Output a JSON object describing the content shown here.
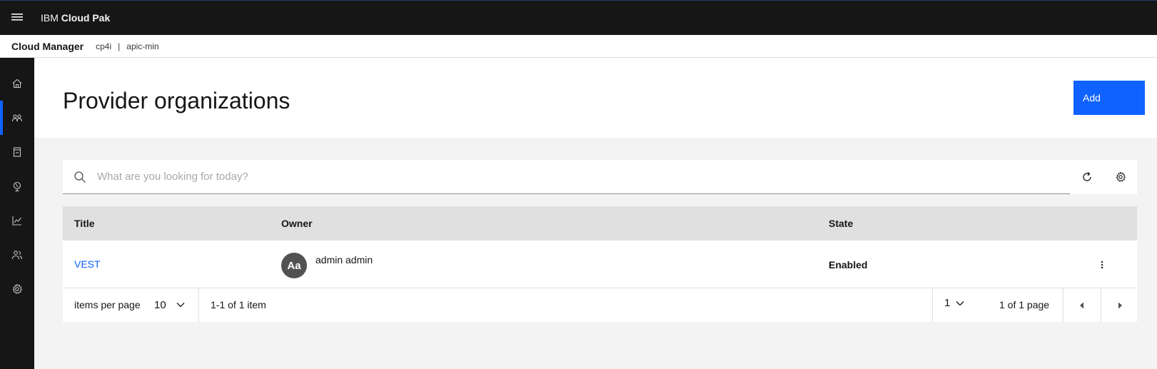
{
  "topbar": {
    "brand_prefix": "IBM",
    "brand_name": "Cloud Pak"
  },
  "breadcrumb": {
    "app": "Cloud Manager",
    "items": [
      "cp4i",
      "apic-min"
    ],
    "separator": "|"
  },
  "rail": {
    "items": [
      {
        "name": "home",
        "icon": "home-icon",
        "active": false
      },
      {
        "name": "provider-organizations",
        "icon": "users-icon",
        "active": true
      },
      {
        "name": "resources",
        "icon": "document-icon",
        "active": false
      },
      {
        "name": "topology",
        "icon": "globe-icon",
        "active": false
      },
      {
        "name": "analytics",
        "icon": "chart-icon",
        "active": false
      },
      {
        "name": "members",
        "icon": "user-group-icon",
        "active": false
      },
      {
        "name": "settings",
        "icon": "gear-icon",
        "active": false
      }
    ]
  },
  "header": {
    "title": "Provider organizations",
    "add_label": "Add"
  },
  "search": {
    "placeholder": "What are you looking for today?",
    "value": ""
  },
  "table": {
    "columns": [
      "Title",
      "Owner",
      "State"
    ],
    "rows": [
      {
        "title": "VEST",
        "owner_initials": "Aa",
        "owner_name": "admin admin",
        "state": "Enabled"
      }
    ]
  },
  "pagination": {
    "items_per_page_label": "items per page",
    "items_per_page": "10",
    "range": "1-1 of 1 item",
    "page": "1",
    "of_pages": "1 of 1 page"
  },
  "colors": {
    "accent": "#0f62fe",
    "shell": "#161616",
    "surface": "#ffffff",
    "background": "#f3f3f3"
  }
}
